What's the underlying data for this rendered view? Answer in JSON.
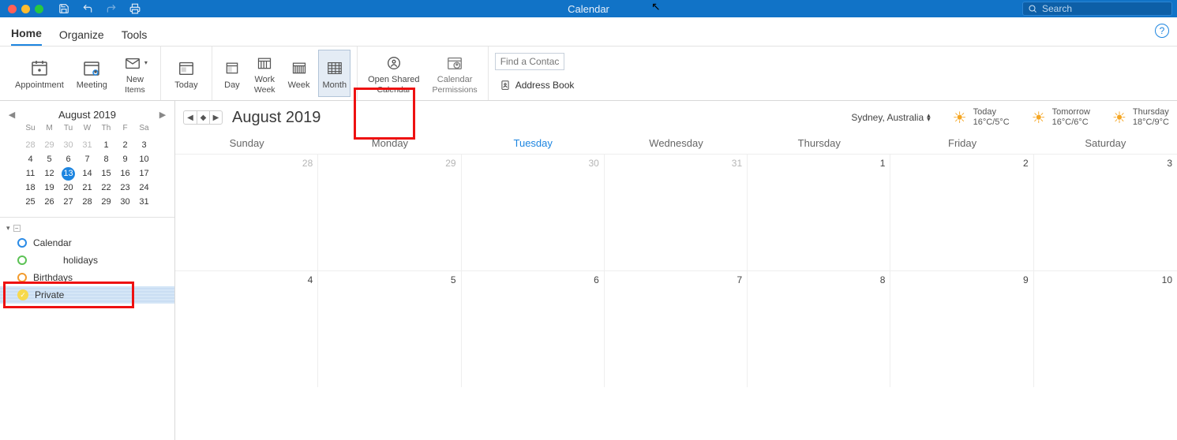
{
  "title": "Calendar",
  "search": {
    "placeholder": "Search"
  },
  "tabs": {
    "home": "Home",
    "organize": "Organize",
    "tools": "Tools"
  },
  "ribbon": {
    "appointment": "Appointment",
    "meeting": "Meeting",
    "newitems1": "New",
    "newitems2": "Items",
    "today": "Today",
    "day": "Day",
    "workweek1": "Work",
    "workweek2": "Week",
    "week": "Week",
    "month": "Month",
    "openshared1": "Open Shared",
    "openshared2": "Calendar",
    "calperm1": "Calendar",
    "calperm2": "Permissions",
    "findcontact": "Find a Contact",
    "addressbook": "Address Book"
  },
  "mini": {
    "title": "August 2019",
    "dow": [
      "Su",
      "M",
      "Tu",
      "W",
      "Th",
      "F",
      "Sa"
    ],
    "days": [
      {
        "n": "28",
        "m": true
      },
      {
        "n": "29",
        "m": true
      },
      {
        "n": "30",
        "m": true
      },
      {
        "n": "31",
        "m": true
      },
      {
        "n": "1"
      },
      {
        "n": "2"
      },
      {
        "n": "3"
      },
      {
        "n": "4"
      },
      {
        "n": "5"
      },
      {
        "n": "6"
      },
      {
        "n": "7"
      },
      {
        "n": "8"
      },
      {
        "n": "9"
      },
      {
        "n": "10"
      },
      {
        "n": "11"
      },
      {
        "n": "12"
      },
      {
        "n": "13",
        "t": true
      },
      {
        "n": "14"
      },
      {
        "n": "15"
      },
      {
        "n": "16"
      },
      {
        "n": "17"
      },
      {
        "n": "18"
      },
      {
        "n": "19"
      },
      {
        "n": "20"
      },
      {
        "n": "21"
      },
      {
        "n": "22"
      },
      {
        "n": "23"
      },
      {
        "n": "24"
      },
      {
        "n": "25"
      },
      {
        "n": "26"
      },
      {
        "n": "27"
      },
      {
        "n": "28"
      },
      {
        "n": "29"
      },
      {
        "n": "30"
      },
      {
        "n": "31"
      }
    ]
  },
  "calendars": {
    "items": [
      {
        "label": "Calendar",
        "color": "blue"
      },
      {
        "label": "holidays",
        "color": "green"
      },
      {
        "label": "Birthdays",
        "color": "orange"
      },
      {
        "label": "Private",
        "color": "yellow",
        "selected": true,
        "checked": true
      }
    ]
  },
  "main": {
    "month": "August 2019",
    "location": "Sydney, Australia",
    "weather": [
      {
        "label": "Today",
        "temp": "16°C/5°C"
      },
      {
        "label": "Tomorrow",
        "temp": "16°C/6°C"
      },
      {
        "label": "Thursday",
        "temp": "18°C/9°C"
      }
    ],
    "dow": [
      "Sunday",
      "Monday",
      "Tuesday",
      "Wednesday",
      "Thursday",
      "Friday",
      "Saturday"
    ],
    "today_index": 2,
    "cells": [
      {
        "n": "28",
        "m": true
      },
      {
        "n": "29",
        "m": true
      },
      {
        "n": "30",
        "m": true
      },
      {
        "n": "31",
        "m": true
      },
      {
        "n": "1"
      },
      {
        "n": "2"
      },
      {
        "n": "3"
      },
      {
        "n": "4"
      },
      {
        "n": "5"
      },
      {
        "n": "6"
      },
      {
        "n": "7"
      },
      {
        "n": "8"
      },
      {
        "n": "9"
      },
      {
        "n": "10"
      }
    ]
  }
}
